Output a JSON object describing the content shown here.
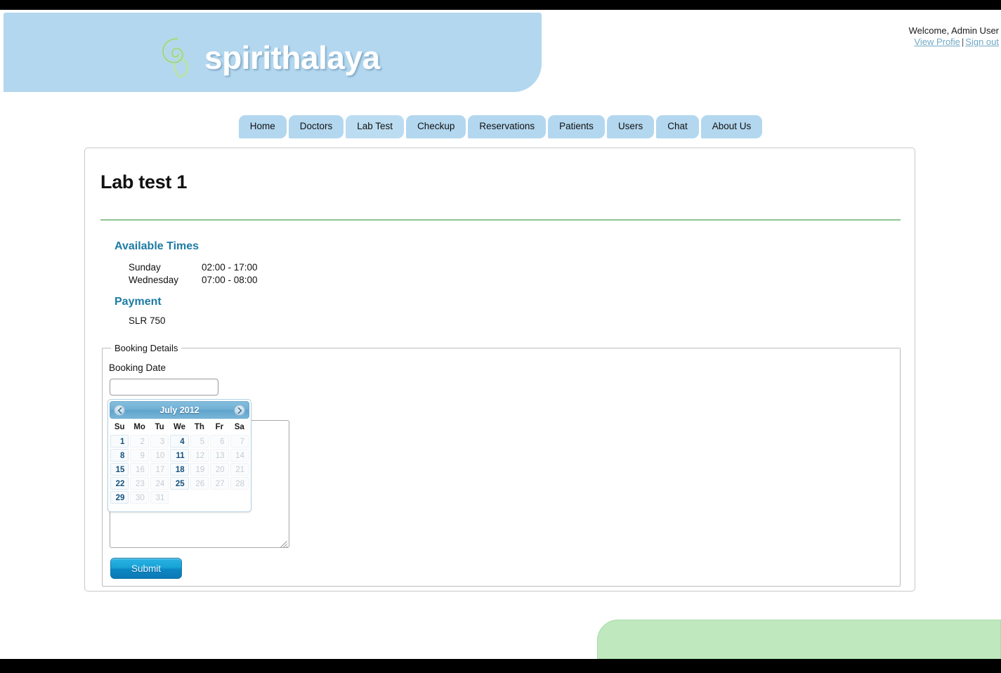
{
  "brand": {
    "name": "spirithalaya",
    "logo_icon": "spiral-logo-icon"
  },
  "user": {
    "welcome": "Welcome, Admin User",
    "view_profile": "View Profie",
    "separator": "|",
    "sign_out": "Sign out"
  },
  "nav": {
    "items": [
      {
        "label": "Home",
        "key": "home",
        "active": false
      },
      {
        "label": "Doctors",
        "key": "doctors",
        "active": false
      },
      {
        "label": "Lab Test",
        "key": "lab-test",
        "active": true
      },
      {
        "label": "Checkup",
        "key": "checkup",
        "active": false
      },
      {
        "label": "Reservations",
        "key": "reservations",
        "active": false
      },
      {
        "label": "Patients",
        "key": "patients",
        "active": false
      },
      {
        "label": "Users",
        "key": "users",
        "active": false
      },
      {
        "label": "Chat",
        "key": "chat",
        "active": false
      },
      {
        "label": "About Us",
        "key": "about-us",
        "active": false
      }
    ]
  },
  "page": {
    "title": "Lab test 1",
    "available_times_heading": "Available Times",
    "available_times": [
      {
        "day": "Sunday",
        "range": "02:00 - 17:00"
      },
      {
        "day": "Wednesday",
        "range": "07:00 - 08:00"
      }
    ],
    "payment_heading": "Payment",
    "payment_value": "SLR 750"
  },
  "booking": {
    "legend": "Booking Details",
    "date_label": "Booking Date",
    "date_value": "",
    "date_placeholder": "",
    "notes_value": "",
    "notes_placeholder": "",
    "submit_label": "Submit"
  },
  "datepicker": {
    "title": "July 2012",
    "prev_icon": "chevron-left-icon",
    "next_icon": "chevron-right-icon",
    "weekdays": [
      "Su",
      "Mo",
      "Tu",
      "We",
      "Th",
      "Fr",
      "Sa"
    ],
    "weeks": [
      [
        {
          "d": "1",
          "state": "enabled"
        },
        {
          "d": "2",
          "state": "disabled"
        },
        {
          "d": "3",
          "state": "disabled"
        },
        {
          "d": "4",
          "state": "enabled"
        },
        {
          "d": "5",
          "state": "disabled"
        },
        {
          "d": "6",
          "state": "disabled"
        },
        {
          "d": "7",
          "state": "disabled"
        }
      ],
      [
        {
          "d": "8",
          "state": "enabled"
        },
        {
          "d": "9",
          "state": "disabled"
        },
        {
          "d": "10",
          "state": "disabled"
        },
        {
          "d": "11",
          "state": "enabled"
        },
        {
          "d": "12",
          "state": "disabled"
        },
        {
          "d": "13",
          "state": "disabled"
        },
        {
          "d": "14",
          "state": "disabled"
        }
      ],
      [
        {
          "d": "15",
          "state": "enabled"
        },
        {
          "d": "16",
          "state": "disabled"
        },
        {
          "d": "17",
          "state": "disabled"
        },
        {
          "d": "18",
          "state": "enabled"
        },
        {
          "d": "19",
          "state": "disabled"
        },
        {
          "d": "20",
          "state": "disabled"
        },
        {
          "d": "21",
          "state": "disabled"
        }
      ],
      [
        {
          "d": "22",
          "state": "enabled"
        },
        {
          "d": "23",
          "state": "disabled"
        },
        {
          "d": "24",
          "state": "disabled"
        },
        {
          "d": "25",
          "state": "enabled"
        },
        {
          "d": "26",
          "state": "disabled"
        },
        {
          "d": "27",
          "state": "disabled"
        },
        {
          "d": "28",
          "state": "disabled"
        }
      ],
      [
        {
          "d": "29",
          "state": "enabled"
        },
        {
          "d": "30",
          "state": "disabled"
        },
        {
          "d": "31",
          "state": "disabled"
        },
        {
          "d": "",
          "state": "empty"
        },
        {
          "d": "",
          "state": "empty"
        },
        {
          "d": "",
          "state": "empty"
        },
        {
          "d": "",
          "state": "empty"
        }
      ]
    ]
  },
  "colors": {
    "header_blue": "#b3d7ef",
    "accent_teal": "#1d7ba3",
    "rule_green": "#8fc48f",
    "footer_green": "#bfe8bf",
    "submit_blue": "#0d86c4",
    "date_enabled_text": "#16517d"
  }
}
